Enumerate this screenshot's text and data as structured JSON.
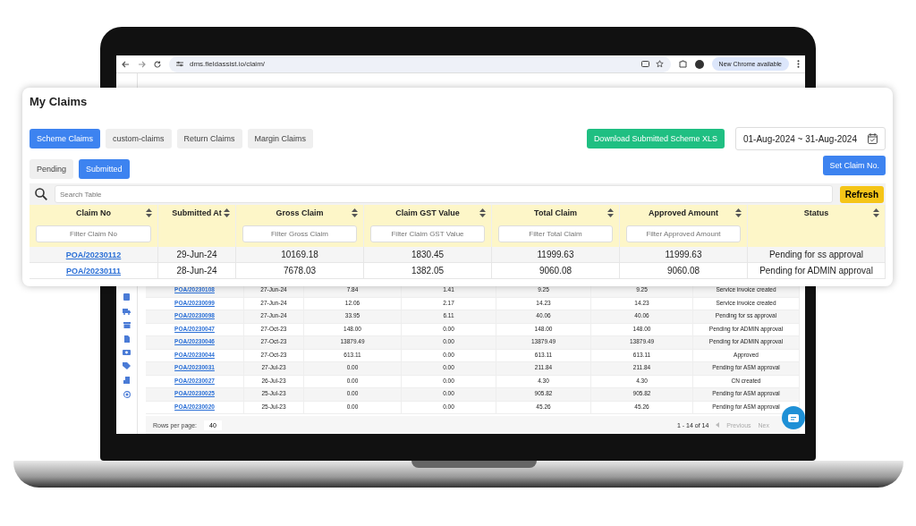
{
  "browser": {
    "url": "dms.fieldassist.io/claim/",
    "update_button": "New Chrome available"
  },
  "background_table": {
    "rows": [
      {
        "claim_no": "POA/20230108",
        "submitted_at": "27-Jun-24",
        "gross_claim": "7.84",
        "claim_gst_value": "1.41",
        "total_claim": "9.25",
        "approved_amount": "9.25",
        "status": "Service invoice created"
      },
      {
        "claim_no": "POA/20230099",
        "submitted_at": "27-Jun-24",
        "gross_claim": "12.06",
        "claim_gst_value": "2.17",
        "total_claim": "14.23",
        "approved_amount": "14.23",
        "status": "Service invoice created"
      },
      {
        "claim_no": "POA/20230098",
        "submitted_at": "27-Jun-24",
        "gross_claim": "33.95",
        "claim_gst_value": "6.11",
        "total_claim": "40.06",
        "approved_amount": "40.06",
        "status": "Pending for ss approval"
      },
      {
        "claim_no": "POA/20230047",
        "submitted_at": "27-Oct-23",
        "gross_claim": "148.00",
        "claim_gst_value": "0.00",
        "total_claim": "148.00",
        "approved_amount": "148.00",
        "status": "Pending for ADMIN approval"
      },
      {
        "claim_no": "POA/20230046",
        "submitted_at": "27-Oct-23",
        "gross_claim": "13879.49",
        "claim_gst_value": "0.00",
        "total_claim": "13879.49",
        "approved_amount": "13879.49",
        "status": "Pending for ADMIN approval"
      },
      {
        "claim_no": "POA/20230044",
        "submitted_at": "27-Oct-23",
        "gross_claim": "613.11",
        "claim_gst_value": "0.00",
        "total_claim": "613.11",
        "approved_amount": "613.11",
        "status": "Approved"
      },
      {
        "claim_no": "POA/20230031",
        "submitted_at": "27-Jul-23",
        "gross_claim": "0.00",
        "claim_gst_value": "0.00",
        "total_claim": "211.84",
        "approved_amount": "211.84",
        "status": "Pending for ASM approval"
      },
      {
        "claim_no": "POA/20230027",
        "submitted_at": "26-Jul-23",
        "gross_claim": "0.00",
        "claim_gst_value": "0.00",
        "total_claim": "4.30",
        "approved_amount": "4.30",
        "status": "CN created"
      },
      {
        "claim_no": "POA/20230025",
        "submitted_at": "25-Jul-23",
        "gross_claim": "0.00",
        "claim_gst_value": "0.00",
        "total_claim": "905.82",
        "approved_amount": "905.82",
        "status": "Pending for ASM approval"
      },
      {
        "claim_no": "POA/20230020",
        "submitted_at": "25-Jul-23",
        "gross_claim": "0.00",
        "claim_gst_value": "0.00",
        "total_claim": "45.26",
        "approved_amount": "45.26",
        "status": "Pending for ASM approval"
      }
    ],
    "footer": {
      "rows_per_page_label": "Rows per page:",
      "rows_per_page": "40",
      "range": "1 - 14 of 14",
      "previous": "Previous",
      "next": "Nex"
    }
  },
  "claims_panel": {
    "title": "My Claims",
    "claim_tabs": [
      {
        "label": "Scheme Claims",
        "selected": true
      },
      {
        "label": "custom-claims",
        "selected": false
      },
      {
        "label": "Return Claims",
        "selected": false
      },
      {
        "label": "Margin Claims",
        "selected": false
      }
    ],
    "download_button": "Download Submitted Scheme XLS",
    "date_range": "01-Aug-2024 ~ 31-Aug-2024",
    "status_tabs": [
      {
        "label": "Pending",
        "selected": false
      },
      {
        "label": "Submitted",
        "selected": true
      }
    ],
    "set_claim_button": "Set Claim No.",
    "search": {
      "placeholder": "Search Table"
    },
    "refresh_button": "Refresh",
    "columns": [
      {
        "label": "Claim No",
        "filter_placeholder": "Filter Claim No"
      },
      {
        "label": "Submitted At"
      },
      {
        "label": "Gross Claim",
        "filter_placeholder": "Filter Gross Claim"
      },
      {
        "label": "Claim GST Value",
        "filter_placeholder": "Filter Claim GST Value"
      },
      {
        "label": "Total Claim",
        "filter_placeholder": "Filter Total Claim"
      },
      {
        "label": "Approved Amount",
        "filter_placeholder": "Filter Approved Amount"
      },
      {
        "label": "Status"
      }
    ],
    "rows": [
      {
        "claim_no": "POA/20230112",
        "submitted_at": "29-Jun-24",
        "gross_claim": "10169.18",
        "claim_gst_value": "1830.45",
        "total_claim": "11999.63",
        "approved_amount": "11999.63",
        "status": "Pending for ss approval"
      },
      {
        "claim_no": "POA/20230111",
        "submitted_at": "28-Jun-24",
        "gross_claim": "7678.03",
        "claim_gst_value": "1382.05",
        "total_claim": "9060.08",
        "approved_amount": "9060.08",
        "status": "Pending for ADMIN approval"
      }
    ]
  }
}
